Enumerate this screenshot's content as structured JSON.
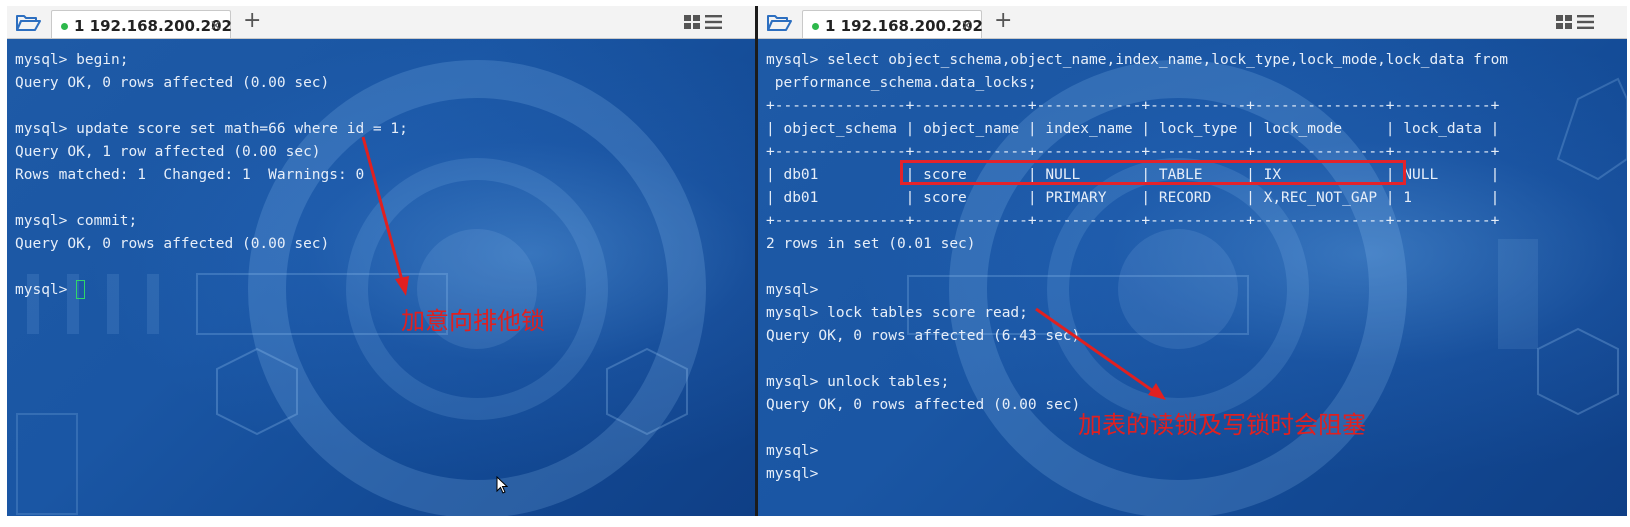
{
  "left": {
    "tab": {
      "label": "1 192.168.200.202",
      "close": "×"
    },
    "add_tab": "+",
    "terminal_lines": [
      "mysql> begin;",
      "Query OK, 0 rows affected (0.00 sec)",
      "",
      "mysql> update score set math=66 where id = 1;",
      "Query OK, 1 row affected (0.00 sec)",
      "Rows matched: 1  Changed: 1  Warnings: 0",
      "",
      "mysql> commit;",
      "Query OK, 0 rows affected (0.00 sec)",
      "",
      "mysql> "
    ],
    "annotation": "加意向排他锁"
  },
  "right": {
    "tab": {
      "label": "1 192.168.200.202",
      "close": "×"
    },
    "add_tab": "+",
    "terminal_lines": [
      "mysql> select object_schema,object_name,index_name,lock_type,lock_mode,lock_data from",
      " performance_schema.data_locks;",
      "+---------------+-------------+------------+-----------+---------------+-----------+",
      "| object_schema | object_name | index_name | lock_type | lock_mode     | lock_data |",
      "+---------------+-------------+------------+-----------+---------------+-----------+",
      "| db01          | score       | NULL       | TABLE     | IX            | NULL      |",
      "| db01          | score       | PRIMARY    | RECORD    | X,REC_NOT_GAP | 1         |",
      "+---------------+-------------+------------+-----------+---------------+-----------+",
      "2 rows in set (0.01 sec)",
      "",
      "mysql>",
      "mysql> lock tables score read;",
      "Query OK, 0 rows affected (6.43 sec)",
      "",
      "mysql> unlock tables;",
      "Query OK, 0 rows affected (0.00 sec)",
      "",
      "mysql>",
      "mysql>"
    ],
    "annotation": "加表的读锁及写锁时会阻塞"
  },
  "icons": {
    "folder": "folder-open-icon",
    "layout": "grid-layout-icon",
    "menu": "hamburger-menu-icon"
  },
  "colors": {
    "annotation": "#e02020",
    "terminal_text": "#e6eef9",
    "status_dot": "#2db84b"
  }
}
